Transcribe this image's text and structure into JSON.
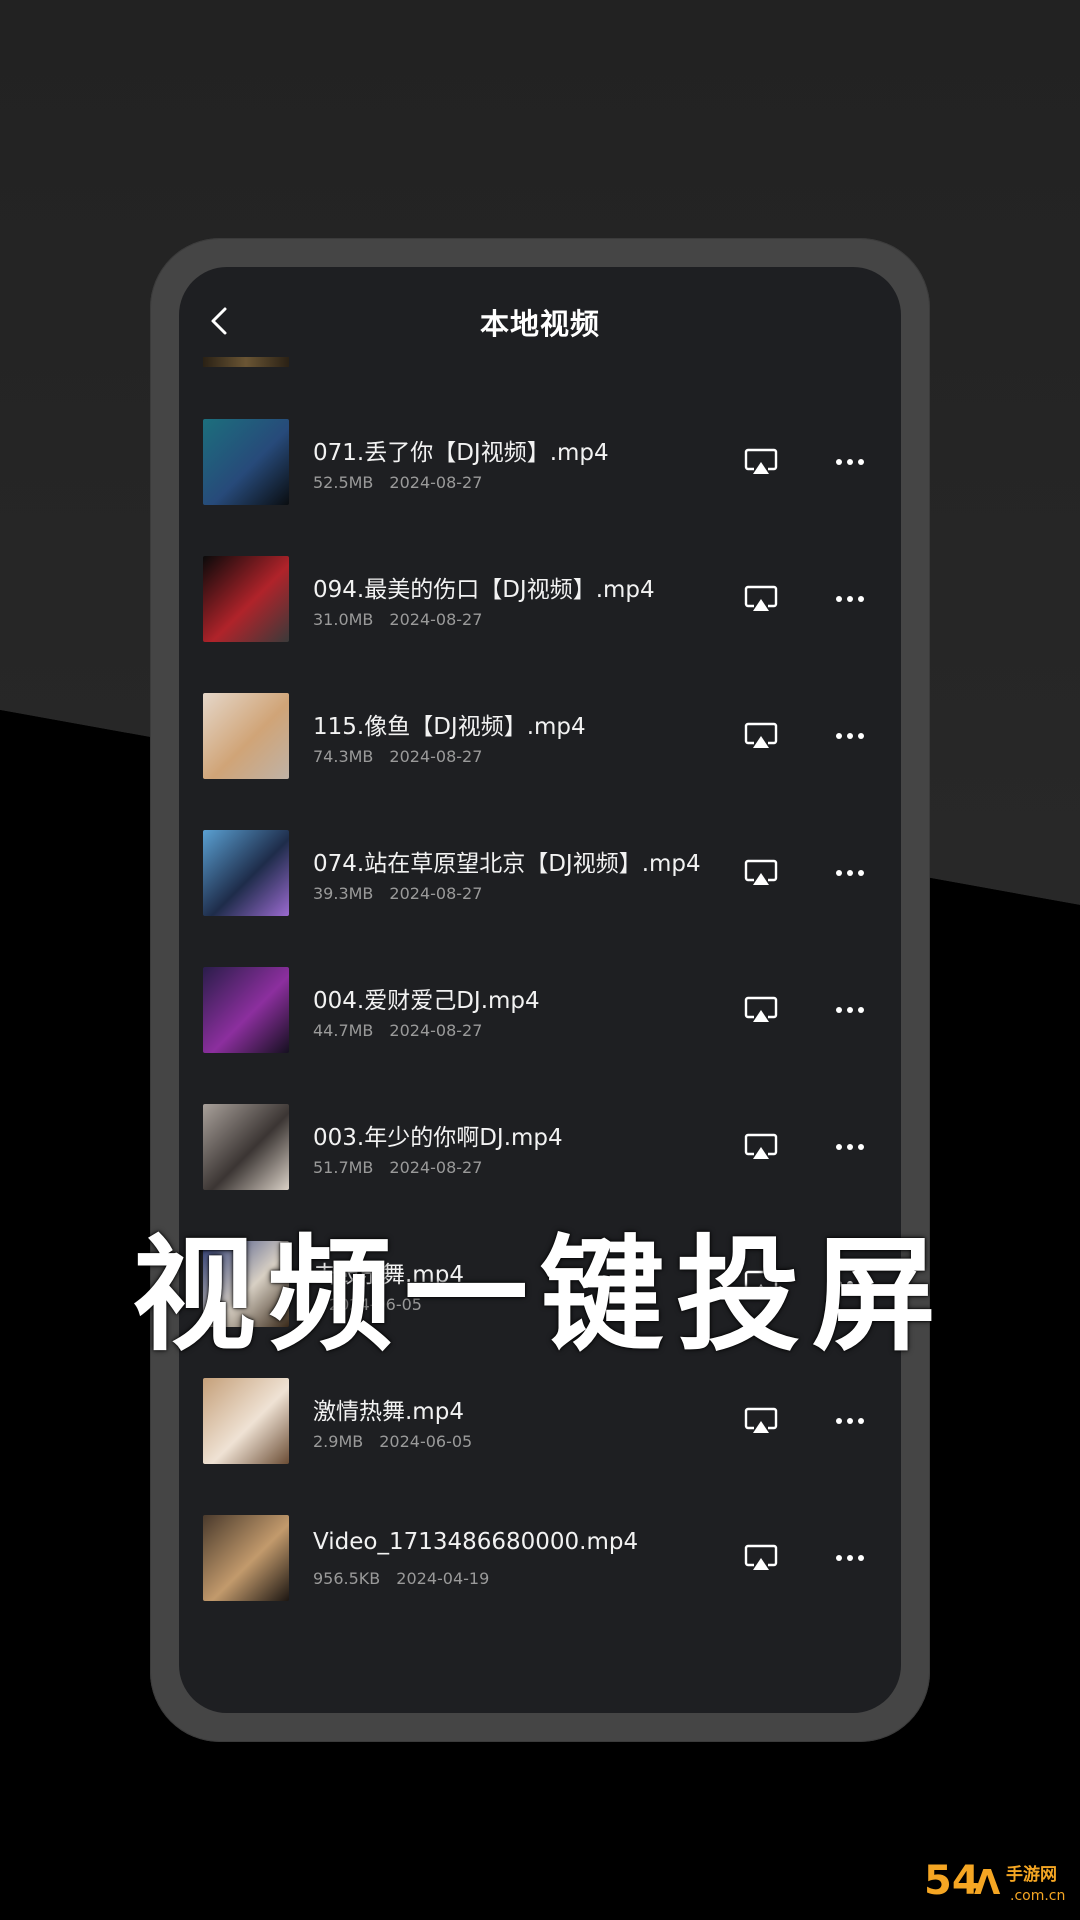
{
  "header": {
    "title": "本地视频"
  },
  "slogan": "视频一键投屏",
  "videos": [
    {
      "name": "071.丢了你【DJ视频】.mp4",
      "size": "52.5MB",
      "date": "2024-08-27",
      "thumb_colors": [
        "#1c6f7d",
        "#274a7a",
        "#0a0d10"
      ]
    },
    {
      "name": "094.最美的伤口【DJ视频】.mp4",
      "size": "31.0MB",
      "date": "2024-08-27",
      "thumb_colors": [
        "#0a0a0a",
        "#b0232a",
        "#3a3a3a"
      ]
    },
    {
      "name": "115.像鱼【DJ视频】.mp4",
      "size": "74.3MB",
      "date": "2024-08-27",
      "thumb_colors": [
        "#e5d7c9",
        "#d0a477",
        "#bfb2a6"
      ]
    },
    {
      "name": "074.站在草原望北京【DJ视频】.mp4",
      "size": "39.3MB",
      "date": "2024-08-27",
      "thumb_colors": [
        "#5aa0d2",
        "#1e2c4a",
        "#9b6ad0"
      ]
    },
    {
      "name": "004.爱财爱己DJ.mp4",
      "size": "44.7MB",
      "date": "2024-08-27",
      "thumb_colors": [
        "#2a1d4a",
        "#8c2f9e",
        "#151020"
      ]
    },
    {
      "name": "003.年少的你啊DJ.mp4",
      "size": "51.7MB",
      "date": "2024-08-27",
      "thumb_colors": [
        "#a8a09a",
        "#3b3533",
        "#d9d0c6"
      ]
    },
    {
      "name": "击鼓乐舞.mp4",
      "size": "",
      "date": "2024-06-05",
      "thumb_colors": [
        "#2e3e7a",
        "#d8d0c4",
        "#3a2a1a"
      ]
    },
    {
      "name": "激情热舞.mp4",
      "size": "2.9MB",
      "date": "2024-06-05",
      "thumb_colors": [
        "#c5a07a",
        "#efe2d4",
        "#6b4d35"
      ]
    },
    {
      "name": "Video_1713486680000.mp4",
      "size": "956.5KB",
      "date": "2024-04-19",
      "thumb_colors": [
        "#4a3a2c",
        "#c29a6c",
        "#1c1612"
      ]
    }
  ],
  "watermark": {
    "brand": "54",
    "sub": "手游网",
    "domain": ".com.cn",
    "color": "#f5a623"
  },
  "icons": {
    "back": "chevron-left-icon",
    "cast": "airplay-icon",
    "more": "more-dots-icon"
  }
}
